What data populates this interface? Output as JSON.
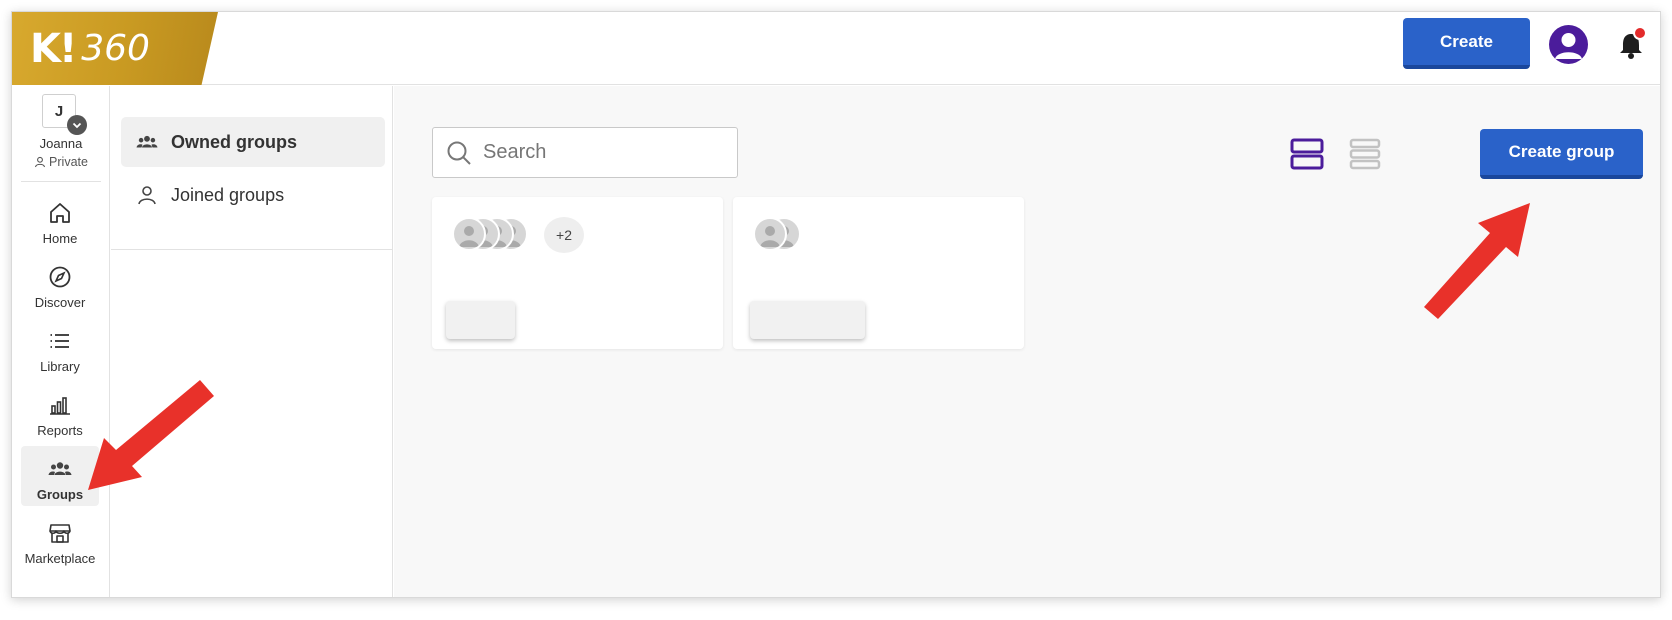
{
  "app": {
    "logo_letter": "K!",
    "logo_suffix": "360",
    "create_label": "Create"
  },
  "profile": {
    "initial": "J",
    "name": "Joanna",
    "type": "Private"
  },
  "sidebar": {
    "items": [
      {
        "label": "Home",
        "icon": "home-icon",
        "active": false
      },
      {
        "label": "Discover",
        "icon": "compass-icon",
        "active": false
      },
      {
        "label": "Library",
        "icon": "list-icon",
        "active": false
      },
      {
        "label": "Reports",
        "icon": "bar-chart-icon",
        "active": false
      },
      {
        "label": "Groups",
        "icon": "groups-icon",
        "active": true
      },
      {
        "label": "Marketplace",
        "icon": "store-icon",
        "active": false
      }
    ]
  },
  "subnav": {
    "items": [
      {
        "label": "Owned groups",
        "icon": "groups-icon",
        "active": true
      },
      {
        "label": "Joined groups",
        "icon": "person-icon",
        "active": false
      }
    ]
  },
  "main": {
    "search_placeholder": "Search",
    "create_group_label": "Create group",
    "cards": [
      {
        "extra_members": "+2"
      },
      {
        "extra_members": ""
      }
    ]
  },
  "colors": {
    "accent": "#2a62c9",
    "logo_gold": "#d0a22a",
    "avatar_purple": "#4b1c9b",
    "notification": "#e32b2b",
    "annotation_arrow": "#e8312a"
  }
}
